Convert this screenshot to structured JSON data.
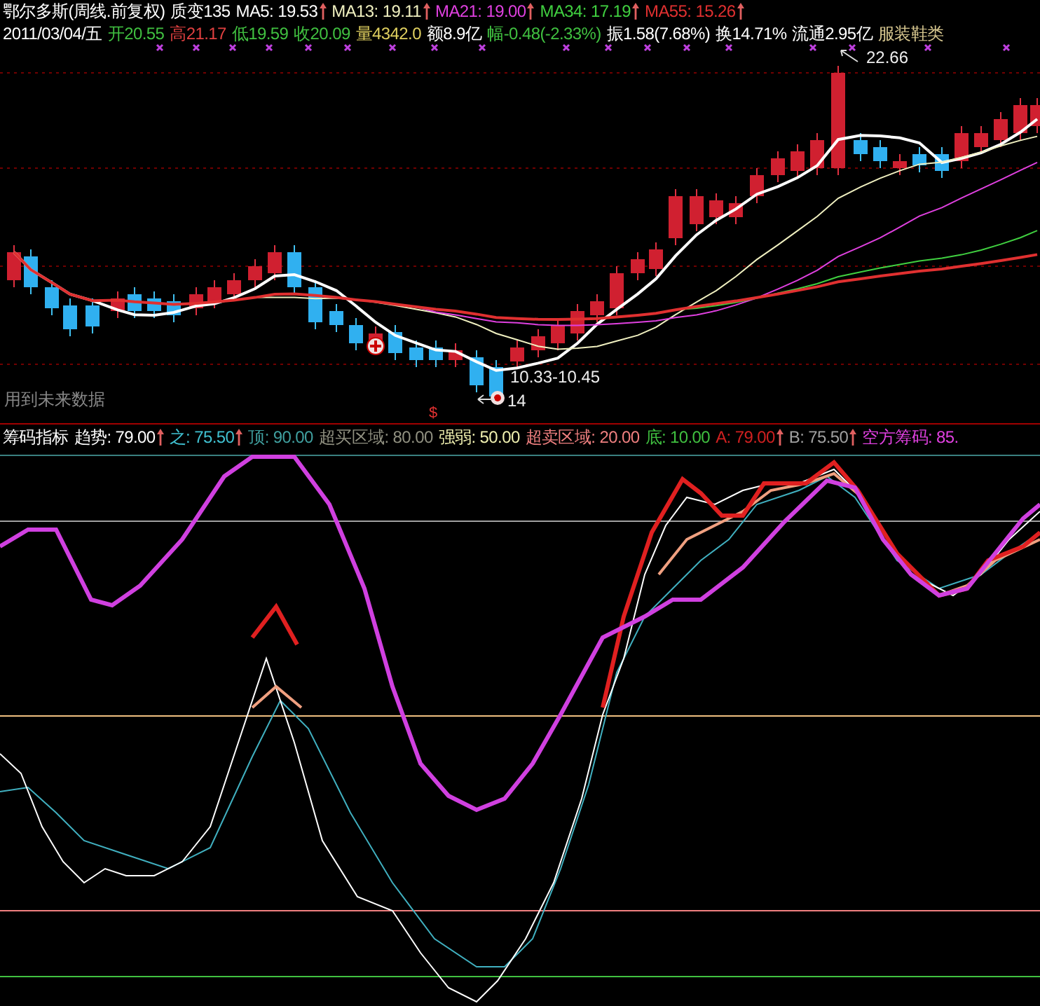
{
  "price_panel": {
    "legend": [
      {
        "text": "鄂尔多斯(周线.前复权)",
        "color": "#ffffff",
        "up_arrow": false
      },
      {
        "text": "质变135",
        "color": "#ffffff",
        "up_arrow": false
      },
      {
        "text": "MA5: 19.53",
        "color": "#ffffff",
        "up_arrow": true
      },
      {
        "text": "MA13: 19.11",
        "color": "#f0f0c0",
        "up_arrow": true
      },
      {
        "text": "MA21: 19.00",
        "color": "#e040e0",
        "up_arrow": true
      },
      {
        "text": "MA34: 17.19",
        "color": "#40d040",
        "up_arrow": true
      },
      {
        "text": "MA55: 15.26",
        "color": "#e03030",
        "up_arrow": true
      }
    ],
    "quote": [
      {
        "text": "2011/03/04/五",
        "color": "#ffffff"
      },
      {
        "text": "开20.55",
        "color": "#40c040"
      },
      {
        "text": "高21.17",
        "color": "#e04040"
      },
      {
        "text": "低19.59",
        "color": "#40c040"
      },
      {
        "text": "收20.09",
        "color": "#40c040"
      },
      {
        "text": "量4342.0",
        "color": "#e0d060"
      },
      {
        "text": "额8.9亿",
        "color": "#ffffff"
      },
      {
        "text": "幅-0.48(-2.33%)",
        "color": "#40c040"
      },
      {
        "text": "振1.58(7.68%)",
        "color": "#ffffff"
      },
      {
        "text": "换14.71%",
        "color": "#ffffff"
      },
      {
        "text": "流通2.95亿",
        "color": "#ffffff"
      },
      {
        "text": "服装鞋类",
        "color": "#d8c890"
      }
    ],
    "annotations": [
      {
        "kind": "high",
        "text": "22.66"
      },
      {
        "kind": "range",
        "text": "10.33-10.45"
      },
      {
        "kind": "low",
        "text": "14"
      }
    ],
    "warning": "用到未来数据",
    "marker": "$"
  },
  "indicator_panel": {
    "legend": [
      {
        "text": "筹码指标",
        "color": "#ffffff",
        "up_arrow": false
      },
      {
        "text": "趋势: 79.00",
        "color": "#ffffff",
        "up_arrow": true
      },
      {
        "text": "之: 75.50",
        "color": "#40c0d0",
        "up_arrow": true
      },
      {
        "text": "顶: 90.00",
        "color": "#40a0a0",
        "up_arrow": false
      },
      {
        "text": "超买区域: 80.00",
        "color": "#909080",
        "up_arrow": false
      },
      {
        "text": "强弱: 50.00",
        "color": "#f0f0b0",
        "up_arrow": false
      },
      {
        "text": "超卖区域: 20.00",
        "color": "#f08080",
        "up_arrow": false
      },
      {
        "text": "底: 10.00",
        "color": "#40c040",
        "up_arrow": false
      },
      {
        "text": "A: 79.00",
        "color": "#d02020",
        "up_arrow": true
      },
      {
        "text": "B: 75.50",
        "color": "#a0a0a0",
        "up_arrow": true
      },
      {
        "text": "空方筹码: 85.",
        "color": "#e040e0",
        "up_arrow": false
      }
    ]
  }
}
